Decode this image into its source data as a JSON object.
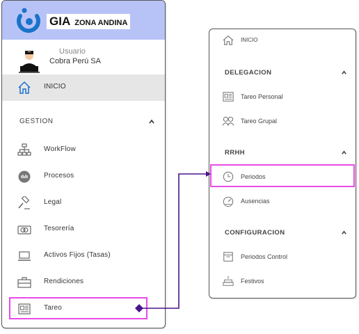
{
  "brand": {
    "name": "GIA",
    "subtitle": "ZONA ANDINA"
  },
  "user": {
    "label": "Usuario",
    "company": "Cobra Perú SA"
  },
  "left_menu": {
    "home": "INICIO",
    "section": "GESTION",
    "items": [
      {
        "label": "WorkFlow",
        "icon": "org-chart-icon"
      },
      {
        "label": "Procesos",
        "icon": "process-icon"
      },
      {
        "label": "Legal",
        "icon": "gavel-icon"
      },
      {
        "label": "Tesorería",
        "icon": "money-icon"
      },
      {
        "label": "Activos Fijos (Tasas)",
        "icon": "laptop-icon"
      },
      {
        "label": "Rendiciones",
        "icon": "briefcase-icon"
      },
      {
        "label": "Tareo",
        "icon": "newspaper-icon"
      }
    ]
  },
  "right_menu": {
    "home": "INICIO",
    "sections": [
      {
        "title": "DELEGACION",
        "items": [
          {
            "label": "Tareo Personal"
          },
          {
            "label": "Tareo Grupal"
          }
        ]
      },
      {
        "title": "RRHH",
        "items": [
          {
            "label": "Periodos"
          },
          {
            "label": "Ausencias"
          }
        ]
      },
      {
        "title": "CONFIGURACION",
        "items": [
          {
            "label": "Periodos Control"
          },
          {
            "label": "Festivos"
          }
        ]
      }
    ]
  },
  "colors": {
    "header_bg": "#b7c3f7",
    "highlight": "#e84be8",
    "connector": "#4a148c",
    "logo": "#1a73c8",
    "active_icon": "#1a6fd1"
  }
}
